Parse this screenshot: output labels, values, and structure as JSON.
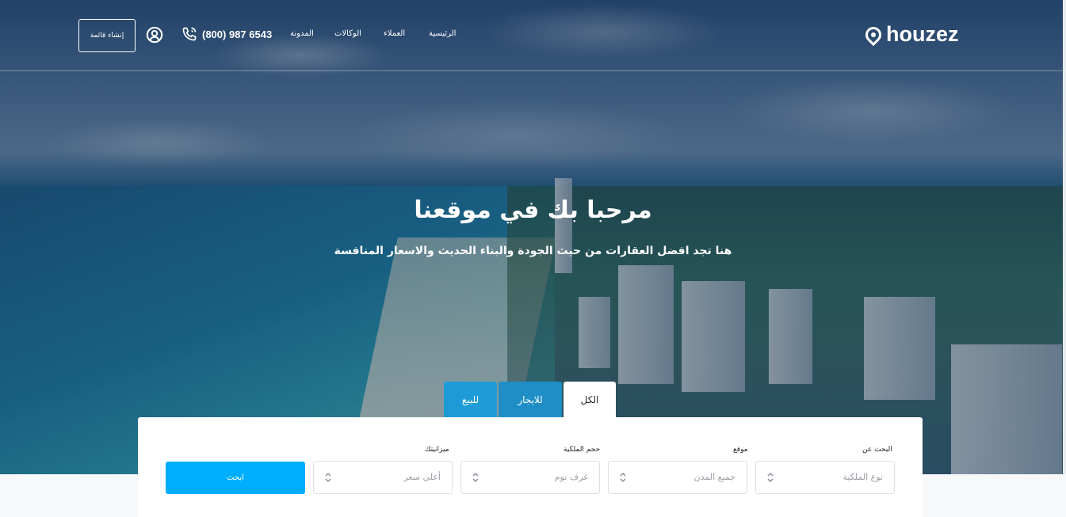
{
  "header": {
    "logo_text": "houzez",
    "nav": {
      "home": "الرئيسية",
      "clients": "العملاء",
      "agencies": "الوكالات",
      "blog": "المدونة"
    },
    "phone": "(800) 987 6543",
    "create_listing": "إنشاء قائمة"
  },
  "hero": {
    "title": "مرحبا بك في موقعنا",
    "subtitle": "هنا تجد افضل العقارات من حيث الجودة والبناء الحديث والاسعار المنافسة"
  },
  "tabs": {
    "all": "الكل",
    "rent": "للايجار",
    "sale": "للبيع"
  },
  "search": {
    "search_for_label": "البحث عن",
    "property_type_placeholder": "نوع الملكية",
    "location_label": "موقع",
    "location_placeholder": "جميع المدن",
    "size_label": "حجم الملكية",
    "rooms_placeholder": "غرف نوم",
    "budget_label": "ميزانيتك",
    "price_placeholder": "أعلى سعر",
    "submit": "ابحث"
  },
  "colors": {
    "accent": "#00aeff",
    "tab_blue": "#1e9bd6"
  }
}
